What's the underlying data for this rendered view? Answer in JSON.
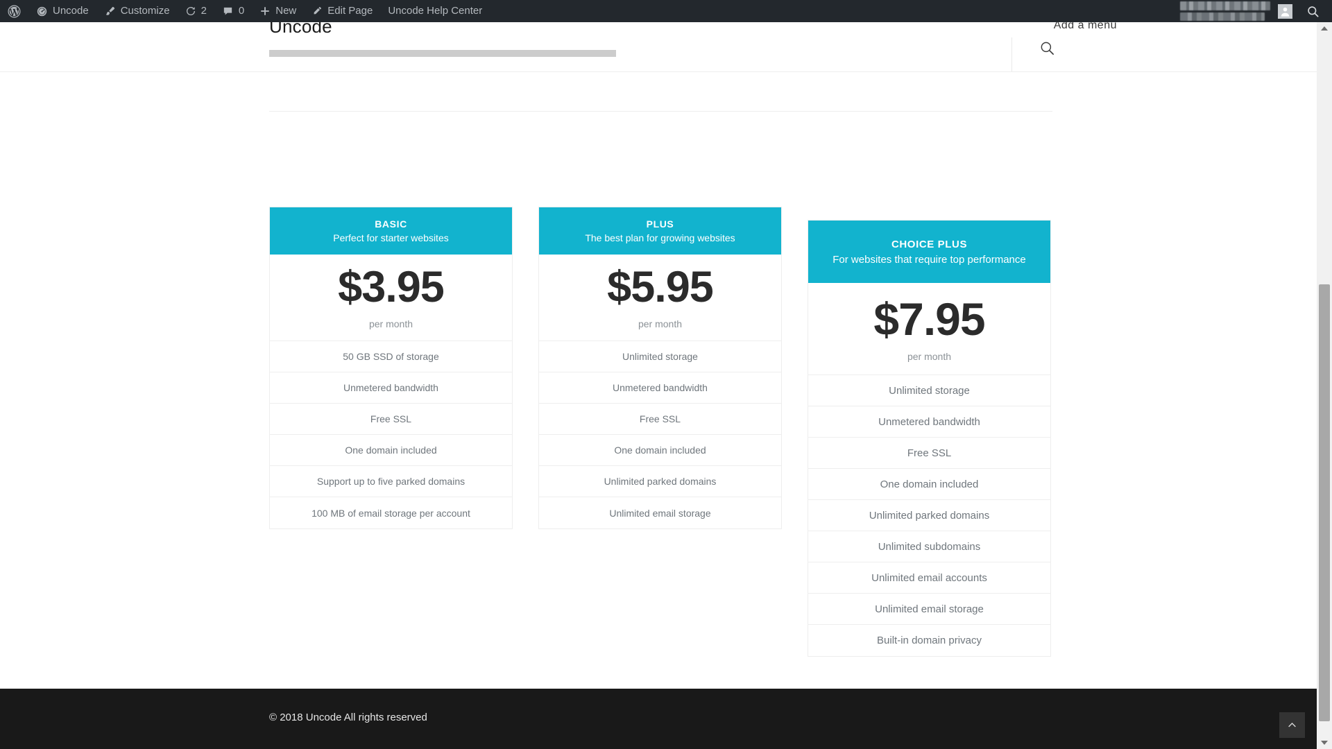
{
  "admin_bar": {
    "items": [
      {
        "icon": "wordpress-logo-icon",
        "label": ""
      },
      {
        "icon": "dashboard-speedometer-icon",
        "label": "Uncode"
      },
      {
        "icon": "paintbrush-icon",
        "label": "Customize"
      },
      {
        "icon": "updates-refresh-icon",
        "label": "2"
      },
      {
        "icon": "comment-bubble-icon",
        "label": "0"
      },
      {
        "icon": "plus-icon",
        "label": "New"
      },
      {
        "icon": "pencil-edit-icon",
        "label": "Edit Page"
      },
      {
        "icon": "",
        "label": "Uncode Help Center"
      }
    ],
    "account": {
      "name_redacted": true,
      "avatar_icon": "user-avatar-icon",
      "search_icon": "search-icon"
    },
    "colors": {
      "background": "#23282d",
      "text": "#b4b9be"
    }
  },
  "site_header": {
    "logo": "Uncode",
    "menu_placeholder": "Add a menu",
    "search_icon": "search-icon"
  },
  "pricing": {
    "accent_color": "#12b3ce",
    "period_label": "per month",
    "plans": [
      {
        "id": "basic",
        "title": "BASIC",
        "subtitle": "Perfect for starter websites",
        "price": "$3.95",
        "period": "per month",
        "features": [
          "50 GB SSD of storage",
          "Unmetered bandwidth",
          "Free SSL",
          "One domain included",
          "Support up to five parked domains",
          "100 MB of email storage per account"
        ]
      },
      {
        "id": "plus",
        "title": "PLUS",
        "subtitle": "The best plan for growing websites",
        "price": "$5.95",
        "period": "per month",
        "features": [
          "Unlimited storage",
          "Unmetered bandwidth",
          "Free SSL",
          "One domain included",
          "Unlimited parked domains",
          "Unlimited email storage"
        ]
      },
      {
        "id": "choice",
        "title": "CHOICE PLUS",
        "subtitle": "For websites that require top performance",
        "price": "$7.95",
        "period": "per month",
        "features": [
          "Unlimited storage",
          "Unmetered bandwidth",
          "Free SSL",
          "One domain included",
          "Unlimited parked domains",
          "Unlimited subdomains",
          "Unlimited email accounts",
          "Unlimited email storage",
          "Built-in domain privacy"
        ]
      }
    ]
  },
  "footer": {
    "copyright": "© 2018 Uncode All rights reserved",
    "back_to_top_icon": "chevron-up-icon",
    "background": "#191919"
  }
}
